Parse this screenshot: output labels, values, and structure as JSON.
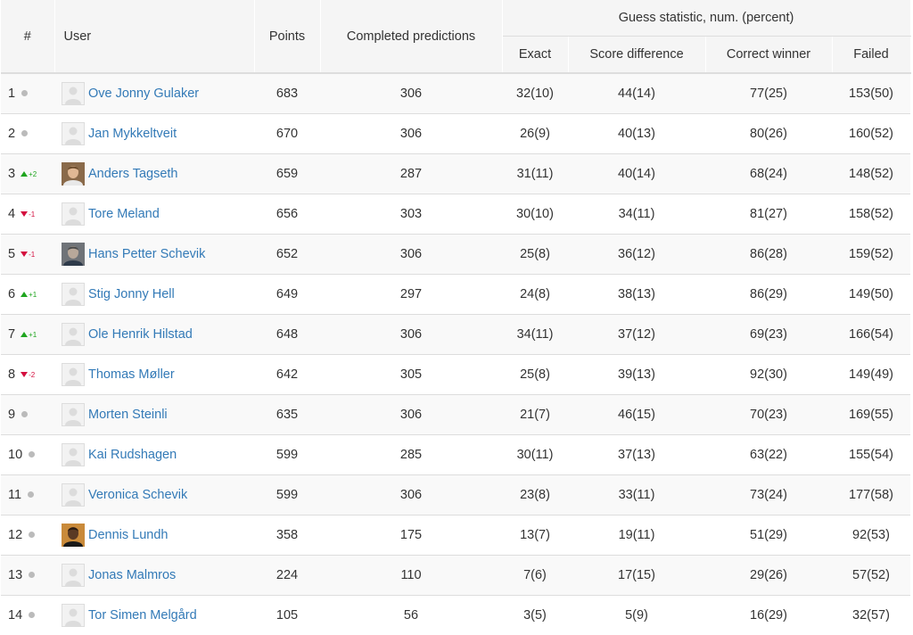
{
  "header": {
    "rank": "#",
    "user": "User",
    "points": "Points",
    "completed": "Completed predictions",
    "guess_group": "Guess statistic, num. (percent)",
    "exact": "Exact",
    "score_diff": "Score difference",
    "correct_winner": "Correct winner",
    "failed": "Failed"
  },
  "colors": {
    "link": "#337ab7",
    "up": "#1fa51f",
    "down": "#d40f3f",
    "neutral_dot": "#bbbbbb",
    "stripe": "#f9f9f9"
  },
  "rows": [
    {
      "rank": "1",
      "change": "",
      "dir": "none",
      "user": "Ove Jonny Gulaker",
      "avatar": "placeholder",
      "points": "683",
      "completed": "306",
      "exact": "32(10)",
      "score_diff": "44(14)",
      "correct_winner": "77(25)",
      "failed": "153(50)"
    },
    {
      "rank": "2",
      "change": "",
      "dir": "none",
      "user": "Jan Mykkeltveit",
      "avatar": "placeholder",
      "points": "670",
      "completed": "306",
      "exact": "26(9)",
      "score_diff": "40(13)",
      "correct_winner": "80(26)",
      "failed": "160(52)"
    },
    {
      "rank": "3",
      "change": "+2",
      "dir": "up",
      "user": "Anders Tagseth",
      "avatar": "photo-light",
      "points": "659",
      "completed": "287",
      "exact": "31(11)",
      "score_diff": "40(14)",
      "correct_winner": "68(24)",
      "failed": "148(52)"
    },
    {
      "rank": "4",
      "change": "-1",
      "dir": "down",
      "user": "Tore Meland",
      "avatar": "placeholder",
      "points": "656",
      "completed": "303",
      "exact": "30(10)",
      "score_diff": "34(11)",
      "correct_winner": "81(27)",
      "failed": "158(52)"
    },
    {
      "rank": "5",
      "change": "-1",
      "dir": "down",
      "user": "Hans Petter Schevik",
      "avatar": "photo-gray",
      "points": "652",
      "completed": "306",
      "exact": "25(8)",
      "score_diff": "36(12)",
      "correct_winner": "86(28)",
      "failed": "159(52)"
    },
    {
      "rank": "6",
      "change": "+1",
      "dir": "up",
      "user": "Stig Jonny Hell",
      "avatar": "placeholder",
      "points": "649",
      "completed": "297",
      "exact": "24(8)",
      "score_diff": "38(13)",
      "correct_winner": "86(29)",
      "failed": "149(50)"
    },
    {
      "rank": "7",
      "change": "+1",
      "dir": "up",
      "user": "Ole Henrik Hilstad",
      "avatar": "placeholder",
      "points": "648",
      "completed": "306",
      "exact": "34(11)",
      "score_diff": "37(12)",
      "correct_winner": "69(23)",
      "failed": "166(54)"
    },
    {
      "rank": "8",
      "change": "-2",
      "dir": "down",
      "user": "Thomas Møller",
      "avatar": "placeholder",
      "points": "642",
      "completed": "305",
      "exact": "25(8)",
      "score_diff": "39(13)",
      "correct_winner": "92(30)",
      "failed": "149(49)"
    },
    {
      "rank": "9",
      "change": "",
      "dir": "none",
      "user": "Morten Steinli",
      "avatar": "placeholder",
      "points": "635",
      "completed": "306",
      "exact": "21(7)",
      "score_diff": "46(15)",
      "correct_winner": "70(23)",
      "failed": "169(55)"
    },
    {
      "rank": "10",
      "change": "",
      "dir": "none",
      "user": "Kai Rudshagen",
      "avatar": "placeholder",
      "points": "599",
      "completed": "285",
      "exact": "30(11)",
      "score_diff": "37(13)",
      "correct_winner": "63(22)",
      "failed": "155(54)"
    },
    {
      "rank": "11",
      "change": "",
      "dir": "none",
      "user": "Veronica Schevik",
      "avatar": "placeholder",
      "points": "599",
      "completed": "306",
      "exact": "23(8)",
      "score_diff": "33(11)",
      "correct_winner": "73(24)",
      "failed": "177(58)"
    },
    {
      "rank": "12",
      "change": "",
      "dir": "none",
      "user": "Dennis Lundh",
      "avatar": "photo-dark",
      "points": "358",
      "completed": "175",
      "exact": "13(7)",
      "score_diff": "19(11)",
      "correct_winner": "51(29)",
      "failed": "92(53)"
    },
    {
      "rank": "13",
      "change": "",
      "dir": "none",
      "user": "Jonas Malmros",
      "avatar": "placeholder",
      "points": "224",
      "completed": "110",
      "exact": "7(6)",
      "score_diff": "17(15)",
      "correct_winner": "29(26)",
      "failed": "57(52)"
    },
    {
      "rank": "14",
      "change": "",
      "dir": "none",
      "user": "Tor Simen Melgård",
      "avatar": "placeholder",
      "points": "105",
      "completed": "56",
      "exact": "3(5)",
      "score_diff": "5(9)",
      "correct_winner": "16(29)",
      "failed": "32(57)"
    }
  ]
}
